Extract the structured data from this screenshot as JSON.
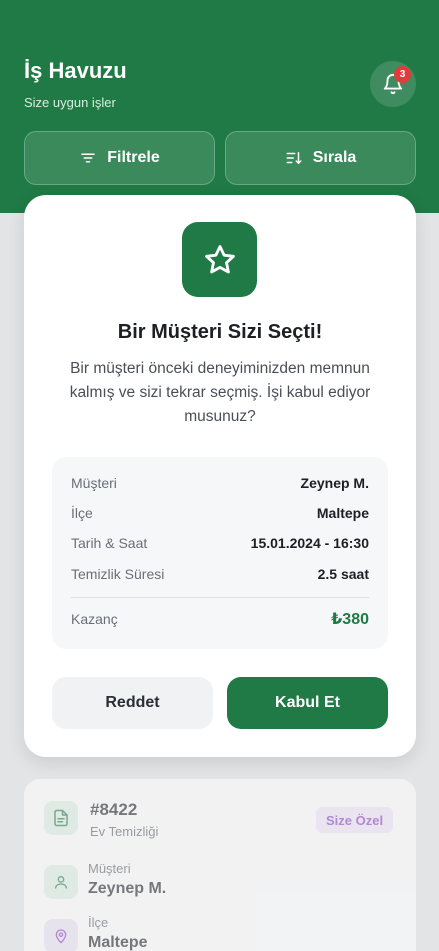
{
  "header": {
    "title": "İş Havuzu",
    "subtitle": "Size uygun işler",
    "notification_count": "3",
    "filter_label": "Filtrele",
    "sort_label": "Sırala"
  },
  "modal": {
    "title": "Bir Müşteri Sizi Seçti!",
    "message": "Bir müşteri önceki deneyiminizden memnun kalmış ve sizi tekrar seçmiş. İşi kabul ediyor musunuz?",
    "details": [
      {
        "label": "Müşteri",
        "value": "Zeynep M."
      },
      {
        "label": "İlçe",
        "value": "Maltepe"
      },
      {
        "label": "Tarih & Saat",
        "value": "15.01.2024 - 16:30"
      },
      {
        "label": "Temizlik Süresi",
        "value": "2.5 saat"
      }
    ],
    "earnings_label": "Kazanç",
    "earnings_value": "₺380",
    "reject_label": "Reddet",
    "accept_label": "Kabul Et"
  },
  "job_card": {
    "id": "#8422",
    "type": "Ev Temizliği",
    "tag": "Size Özel",
    "customer_label": "Müşteri",
    "customer_value": "Zeynep M.",
    "district_label": "İlçe",
    "district_value": "Maltepe"
  },
  "colors": {
    "brand": "#1f7a45",
    "badge": "#e23b3b",
    "tag": "#8a3fc0"
  }
}
